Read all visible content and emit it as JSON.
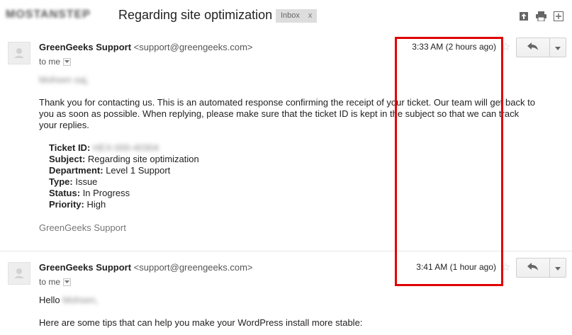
{
  "header": {
    "blurred_label": "MOSTANSTEP",
    "subject": "Regarding site optimization",
    "badge_label": "Inbox",
    "badge_close": "x"
  },
  "messages": [
    {
      "sender_name": "GreenGeeks Support",
      "sender_email": "<support@greengeeks.com>",
      "to_label": "to me",
      "time": "3:33 AM (2 hours ago)",
      "salutation": "Mohsen saj,",
      "paragraph": "Thank you for contacting us. This is an automated response confirming the receipt of your ticket. Our team will get back to you as soon as possible. When replying, please make sure that the ticket ID is kept in the subject so that we can track your replies.",
      "ticket": [
        {
          "label": "Ticket ID:",
          "value": "HEX-000-40304"
        },
        {
          "label": "Subject:",
          "value": "Regarding site optimization"
        },
        {
          "label": "Department:",
          "value": "Level 1 Support"
        },
        {
          "label": "Type:",
          "value": "Issue"
        },
        {
          "label": "Status:",
          "value": "In Progress"
        },
        {
          "label": "Priority:",
          "value": "High"
        }
      ],
      "signature": "GreenGeeks Support"
    },
    {
      "sender_name": "GreenGeeks Support",
      "sender_email": "<support@greengeeks.com>",
      "to_label": "to me",
      "time": "3:41 AM (1 hour ago)",
      "greeting": "Hello",
      "greeting_name": "Mohsen,",
      "paragraph": "Here are some tips that can help you make your WordPress install more stable:"
    }
  ],
  "icons": {
    "new_window": "new-window-icon",
    "print": "print-icon",
    "expand": "expand-icon",
    "reply": "reply-icon",
    "more": "chevron-down-icon",
    "star": "star-icon",
    "avatar": "avatar-icon"
  },
  "colors": {
    "annotation_red": "#e00000",
    "badge_bg": "#dddddd"
  }
}
